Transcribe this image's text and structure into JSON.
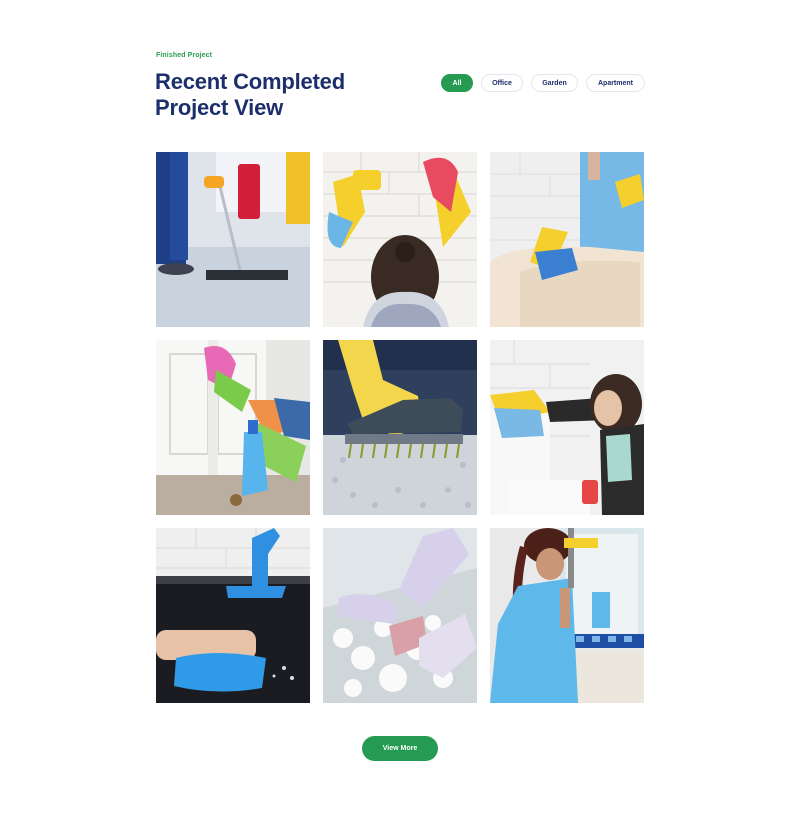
{
  "section": {
    "eyebrow": "Finished Project",
    "title": "Recent Completed Project View"
  },
  "filters": [
    {
      "label": "All",
      "active": true
    },
    {
      "label": "Office",
      "active": false
    },
    {
      "label": "Garden",
      "active": false
    },
    {
      "label": "Apartment",
      "active": false
    }
  ],
  "gallery": {
    "items": [
      {
        "subject": "mopping-floor"
      },
      {
        "subject": "cleaning-tile-wall"
      },
      {
        "subject": "wiping-bathtub"
      },
      {
        "subject": "cleaning-kitchen-cabinet"
      },
      {
        "subject": "brushing-carpet"
      },
      {
        "subject": "cleaning-toilet-tank"
      },
      {
        "subject": "wiping-stovetop"
      },
      {
        "subject": "scrubbing-floor"
      },
      {
        "subject": "washing-mirror"
      }
    ]
  },
  "actions": {
    "view_more_label": "View More"
  },
  "colors": {
    "accent_green": "#249a52",
    "heading_navy": "#1c2f6b"
  }
}
